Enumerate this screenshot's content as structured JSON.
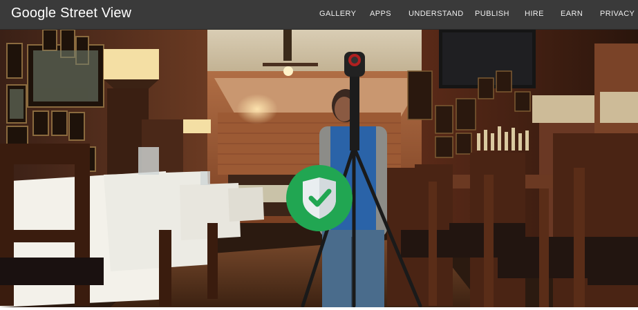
{
  "header": {
    "brand_google": "Google",
    "brand_product": "Street View"
  },
  "nav": {
    "items": [
      {
        "label": "GALLERY"
      },
      {
        "label": "APPS"
      },
      {
        "label": "UNDERSTAND"
      },
      {
        "label": "PUBLISH"
      },
      {
        "label": "HIRE"
      },
      {
        "label": "EARN"
      },
      {
        "label": "PRIVACY"
      }
    ]
  },
  "hero": {
    "badge_icon": "shield-check-icon",
    "colors": {
      "badge_green": "#21a652",
      "topbar": "#3a3a3a",
      "wood": "#5a2e1a"
    }
  }
}
